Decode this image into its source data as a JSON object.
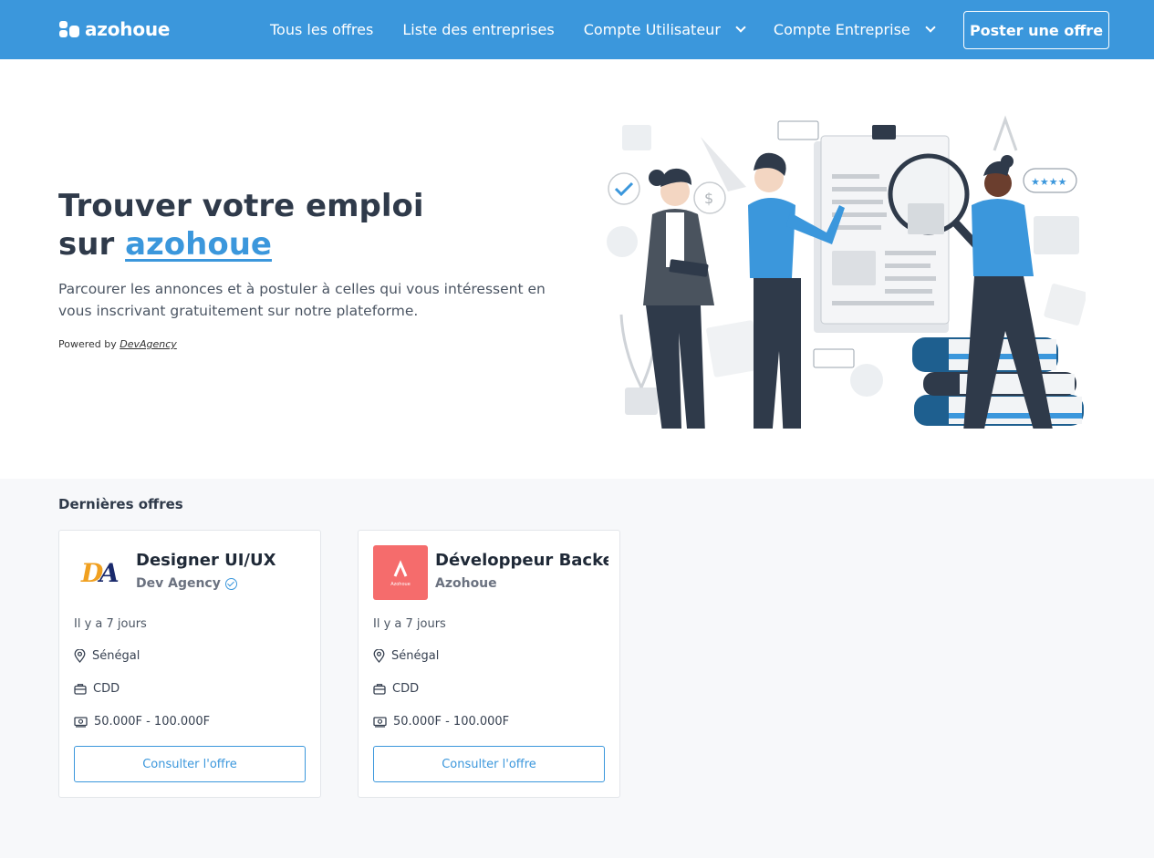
{
  "nav": {
    "logo_text": "azohoue",
    "links": [
      "Tous les offres",
      "Liste des entreprises",
      "Compte Utilisateur",
      "Compte Entreprise"
    ],
    "post_button": "Poster une offre"
  },
  "hero": {
    "title_line1": "Trouver votre emploi",
    "title_line2_prefix": "sur",
    "title_brand": "azohoue",
    "description": "Parcourer les annonces et à postuler à celles qui vous intéressent en vous inscrivant gratuitement sur notre plateforme.",
    "powered_prefix": "Powered by",
    "powered_link": "DevAgency"
  },
  "offers": {
    "section_title": "Dernières offres",
    "items": [
      {
        "title": "Designer UI/UX",
        "company": "Dev Agency",
        "verified": true,
        "logo_text": "DA",
        "date": "Il y a 7 jours",
        "location": "Sénégal",
        "contract": "CDD",
        "salary": "50.000F - 100.000F",
        "button": "Consulter l'offre"
      },
      {
        "title": "Développeur Backend",
        "company": "Azohoue",
        "verified": false,
        "logo_text": "Azohoue",
        "logo_color": "#f56c6c",
        "date": "Il y a 7 jours",
        "location": "Sénégal",
        "contract": "CDD",
        "salary": "50.000F - 100.000F",
        "button": "Consulter l'offre"
      }
    ]
  },
  "colors": {
    "primary": "#3b97dc",
    "dark": "#2f3a4a",
    "azohoue_logo_bg": "#f56c6c"
  }
}
